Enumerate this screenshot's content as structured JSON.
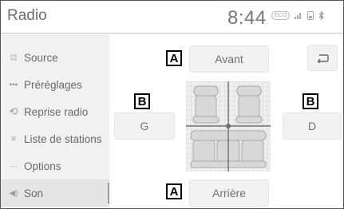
{
  "header": {
    "title": "Radio",
    "clock": "8:44",
    "status_pill": "ECO"
  },
  "sidebar": {
    "items": [
      {
        "label": "Source",
        "icon": "source-icon"
      },
      {
        "label": "Préréglages",
        "icon": "presets-icon"
      },
      {
        "label": "Reprise radio",
        "icon": "radio-replay-icon"
      },
      {
        "label": "Liste de stations",
        "icon": "station-list-icon"
      },
      {
        "label": "Options",
        "icon": "options-icon"
      },
      {
        "label": "Son",
        "icon": "speaker-icon",
        "active": true
      }
    ]
  },
  "balance": {
    "front": "Avant",
    "rear": "Arrière",
    "left": "G",
    "right": "D"
  },
  "callouts": {
    "a_top": "A",
    "a_bottom": "A",
    "b_left": "B",
    "b_right": "B"
  },
  "back_button": {
    "icon": "back-arrow-icon"
  }
}
